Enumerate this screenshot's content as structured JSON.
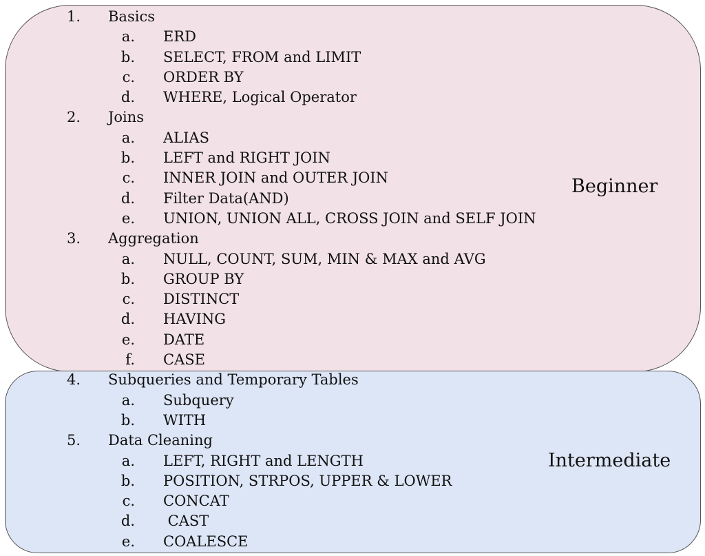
{
  "colors": {
    "beginner_fill": "#f2e2e8",
    "intermediate_fill": "#dde6f6",
    "border": "#555555"
  },
  "levels": {
    "beginner": "Beginner",
    "intermediate": "Intermediate"
  },
  "sections": [
    {
      "marker": "1.",
      "title": "Basics",
      "items": [
        {
          "marker": "a.",
          "text": "ERD"
        },
        {
          "marker": "b.",
          "text": "SELECT, FROM and LIMIT"
        },
        {
          "marker": "c.",
          "text": "ORDER BY"
        },
        {
          "marker": "d.",
          "text": "WHERE, Logical Operator"
        }
      ]
    },
    {
      "marker": "2.",
      "title": "Joins",
      "items": [
        {
          "marker": "a.",
          "text": "ALIAS"
        },
        {
          "marker": "b.",
          "text": "LEFT and RIGHT JOIN"
        },
        {
          "marker": "c.",
          "text": "INNER JOIN and OUTER JOIN"
        },
        {
          "marker": "d.",
          "text": "Filter Data(AND)"
        },
        {
          "marker": "e.",
          "text": "UNION, UNION ALL, CROSS JOIN and SELF JOIN"
        }
      ]
    },
    {
      "marker": "3.",
      "title": "Aggregation",
      "items": [
        {
          "marker": "a.",
          "text": "NULL, COUNT, SUM, MIN & MAX and AVG"
        },
        {
          "marker": "b.",
          "text": "GROUP BY"
        },
        {
          "marker": "c.",
          "text": "DISTINCT"
        },
        {
          "marker": "d.",
          "text": "HAVING"
        },
        {
          "marker": "e.",
          "text": "DATE"
        },
        {
          "marker": "f.",
          "text": "CASE"
        }
      ]
    },
    {
      "marker": "4.",
      "title": "Subqueries and Temporary Tables",
      "items": [
        {
          "marker": "a.",
          "text": "Subquery"
        },
        {
          "marker": "b.",
          "text": "WITH"
        }
      ]
    },
    {
      "marker": "5.",
      "title": "Data Cleaning",
      "items": [
        {
          "marker": "a.",
          "text": "LEFT, RIGHT and LENGTH"
        },
        {
          "marker": "b.",
          "text": "POSITION, STRPOS, UPPER & LOWER"
        },
        {
          "marker": "c.",
          "text": "CONCAT"
        },
        {
          "marker": "d.",
          "text": " CAST"
        },
        {
          "marker": "e.",
          "text": "COALESCE"
        }
      ]
    }
  ]
}
